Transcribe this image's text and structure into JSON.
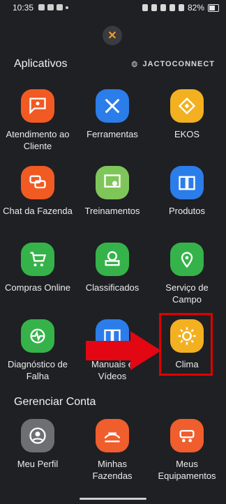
{
  "status_bar": {
    "time": "10:35",
    "battery": "82%"
  },
  "sections": {
    "applications_title": "Aplicativos",
    "account_title": "Gerenciar Conta",
    "brand": "JACTOCONNECT"
  },
  "apps": [
    {
      "label": "Atendimento ao Cliente",
      "icon": "chat-person-icon",
      "color": "#f15a22"
    },
    {
      "label": "Ferramentas",
      "icon": "tools-icon",
      "color": "#2b7de9"
    },
    {
      "label": "EKOS",
      "icon": "ekos-icon",
      "color": "#f3b020"
    },
    {
      "label": "Chat da Fazenda",
      "icon": "chat-bubbles-icon",
      "color": "#f15a22"
    },
    {
      "label": "Treinamentos",
      "icon": "training-icon",
      "color": "#7fc65a"
    },
    {
      "label": "Produtos",
      "icon": "book-icon",
      "color": "#2b7de9"
    },
    {
      "label": "Compras Online",
      "icon": "cart-icon",
      "color": "#35b34a"
    },
    {
      "label": "Classificados",
      "icon": "classifieds-icon",
      "color": "#35b34a"
    },
    {
      "label": "Serviço de Campo",
      "icon": "map-pin-icon",
      "color": "#35b34a"
    },
    {
      "label": "Diagnóstico de Falha",
      "icon": "diagnostic-icon",
      "color": "#35b34a"
    },
    {
      "label": "Manuais e Vídeos",
      "icon": "manuals-icon",
      "color": "#2b7de9"
    },
    {
      "label": "Clima",
      "icon": "sun-icon",
      "color": "#f3b020"
    }
  ],
  "account": [
    {
      "label": "Meu Perfil",
      "icon": "profile-icon",
      "color": "#6d6f73"
    },
    {
      "label": "Minhas Fazendas",
      "icon": "farm-icon",
      "color": "#ef5e2c"
    },
    {
      "label": "Meus Equipamentos",
      "icon": "equipment-icon",
      "color": "#ef5e2c"
    }
  ]
}
